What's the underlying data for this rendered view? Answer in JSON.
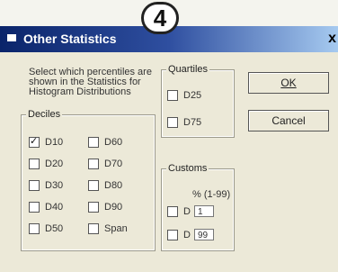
{
  "window": {
    "title": "Other Statistics",
    "close_glyph": "x"
  },
  "step_badge": "4",
  "description": "Select which percentiles are shown in the Statistics for Histogram Distributions",
  "deciles": {
    "label": "Deciles",
    "items": [
      {
        "label": "D10",
        "checked": true
      },
      {
        "label": "D20",
        "checked": false
      },
      {
        "label": "D30",
        "checked": false
      },
      {
        "label": "D40",
        "checked": false
      },
      {
        "label": "D50",
        "checked": false
      },
      {
        "label": "D60",
        "checked": false
      },
      {
        "label": "D70",
        "checked": false
      },
      {
        "label": "D80",
        "checked": false
      },
      {
        "label": "D90",
        "checked": false
      },
      {
        "label": "Span",
        "checked": false
      }
    ]
  },
  "quartiles": {
    "label": "Quartiles",
    "items": [
      {
        "label": "D25",
        "checked": false
      },
      {
        "label": "D75",
        "checked": false
      }
    ]
  },
  "customs": {
    "label": "Customs",
    "range_label": "% (1-99)",
    "items": [
      {
        "label": "D",
        "value": "1",
        "checked": false
      },
      {
        "label": "D",
        "value": "99",
        "checked": false
      }
    ]
  },
  "buttons": {
    "ok": "OK",
    "cancel": "Cancel"
  }
}
